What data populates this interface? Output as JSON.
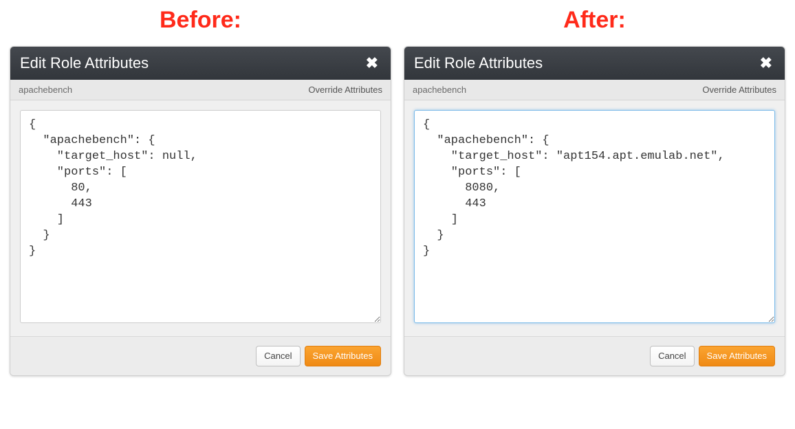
{
  "headings": {
    "before": "Before:",
    "after": "After:"
  },
  "modals": {
    "before": {
      "title": "Edit Role Attributes",
      "breadcrumb_left": "apachebench",
      "breadcrumb_right": "Override Attributes",
      "code": "{\n  \"apachebench\": {\n    \"target_host\": null,\n    \"ports\": [\n      80,\n      443\n    ]\n  }\n}",
      "cancel_label": "Cancel",
      "save_label": "Save Attributes",
      "focused": false
    },
    "after": {
      "title": "Edit Role Attributes",
      "breadcrumb_left": "apachebench",
      "breadcrumb_right": "Override Attributes",
      "code": "{\n  \"apachebench\": {\n    \"target_host\": \"apt154.apt.emulab.net\",\n    \"ports\": [\n      8080,\n      443\n    ]\n  }\n}",
      "cancel_label": "Cancel",
      "save_label": "Save Attributes",
      "focused": true
    }
  },
  "icons": {
    "close": "✖"
  },
  "colors": {
    "heading": "#ff2a1a",
    "modal_header_bg": "#3b3f44",
    "save_btn_bg": "#f7941e",
    "focus_border": "#79b9e8"
  }
}
